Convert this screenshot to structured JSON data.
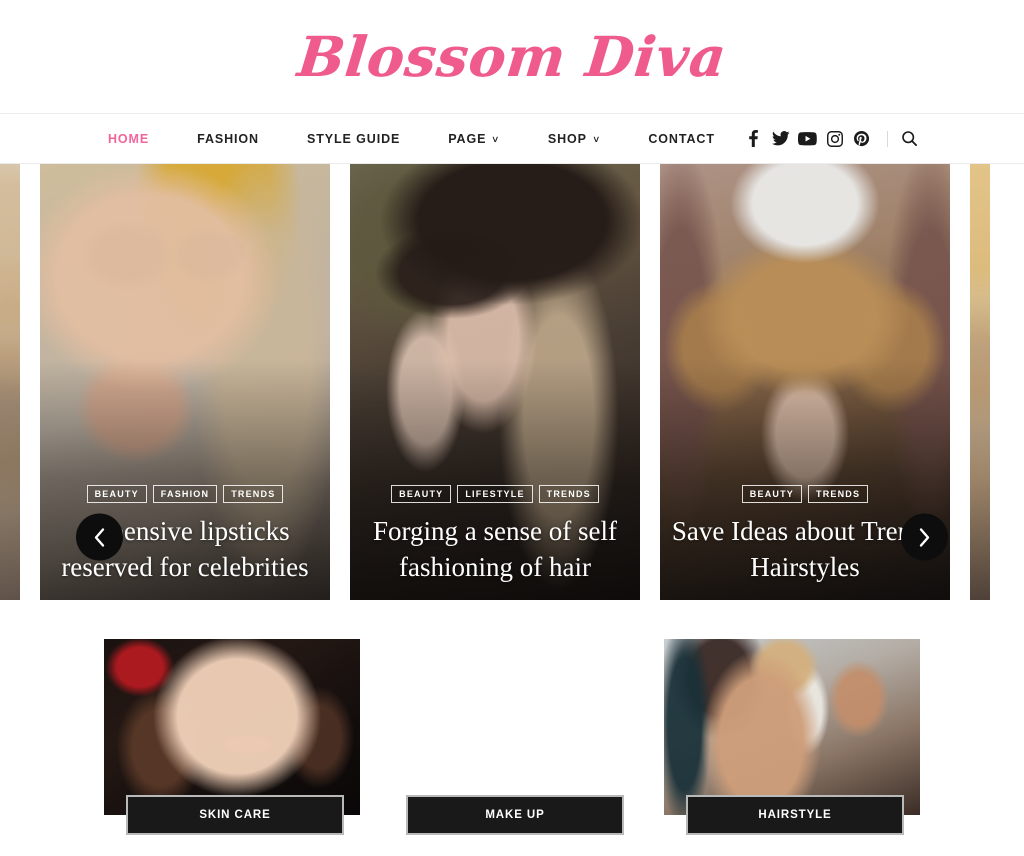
{
  "site": {
    "logo_text": "Blossom Diva",
    "brand_color": "#ef5b8c",
    "accent_dark": "#191919"
  },
  "nav": {
    "items": [
      {
        "label": "HOME",
        "active": true,
        "has_dropdown": false
      },
      {
        "label": "FASHION",
        "active": false,
        "has_dropdown": false
      },
      {
        "label": "STYLE GUIDE",
        "active": false,
        "has_dropdown": false
      },
      {
        "label": "PAGE",
        "active": false,
        "has_dropdown": true
      },
      {
        "label": "SHOP",
        "active": false,
        "has_dropdown": true
      },
      {
        "label": "CONTACT",
        "active": false,
        "has_dropdown": false
      }
    ],
    "caret": "∨",
    "social": [
      {
        "name": "facebook-icon"
      },
      {
        "name": "twitter-icon"
      },
      {
        "name": "youtube-icon"
      },
      {
        "name": "instagram-icon"
      },
      {
        "name": "pinterest-icon"
      }
    ],
    "search_icon": "search-icon"
  },
  "slider": {
    "prev_label": "‹",
    "next_label": "›",
    "slides": [
      {
        "id": "slide-edge-left",
        "partial": true,
        "tags": [],
        "title": ""
      },
      {
        "id": "slide-1",
        "partial": false,
        "tags": [
          "BEAUTY",
          "FASHION",
          "TRENDS"
        ],
        "title": "Expensive lipsticks reserved for celebrities"
      },
      {
        "id": "slide-2",
        "partial": false,
        "tags": [
          "BEAUTY",
          "LIFESTYLE",
          "TRENDS"
        ],
        "title": "Forging a sense of self fashioning of hair"
      },
      {
        "id": "slide-3",
        "partial": false,
        "tags": [
          "BEAUTY",
          "TRENDS"
        ],
        "title": "Save Ideas about Trendy Hairstyles"
      },
      {
        "id": "slide-edge-right",
        "partial": true,
        "tags": [],
        "title": ""
      }
    ]
  },
  "categories": [
    {
      "label": "SKIN CARE"
    },
    {
      "label": "MAKE UP"
    },
    {
      "label": "HAIRSTYLE"
    }
  ]
}
